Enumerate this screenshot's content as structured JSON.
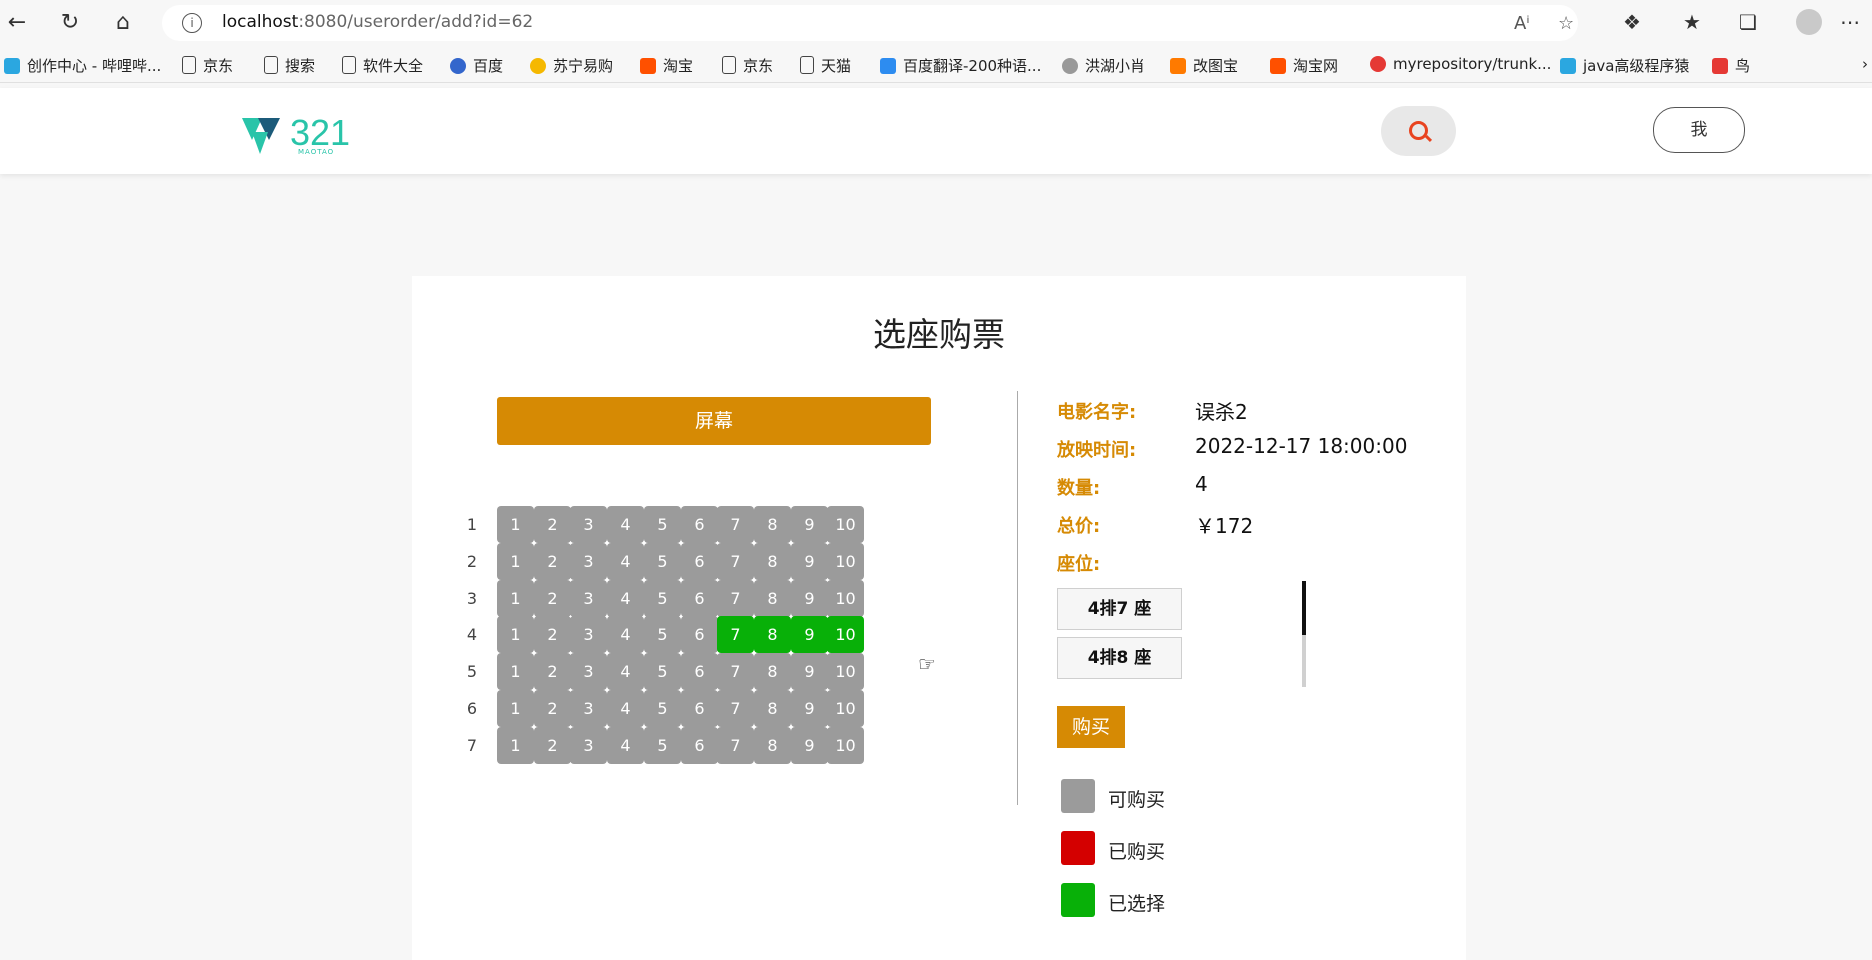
{
  "browser": {
    "url_host": "localhost",
    "url_path": ":8080/userorder/add?id=62",
    "bookmarks": [
      "创作中心 - 哔哩哔...",
      "京东",
      "搜索",
      "软件大全",
      "百度",
      "苏宁易购",
      "淘宝",
      "京东",
      "天猫",
      "百度翻译-200种语...",
      "洪湖小肖",
      "改图宝",
      "淘宝网",
      "myrepository/trunk...",
      "java高级程序猿",
      "鸟"
    ]
  },
  "header": {
    "logo_text": "321",
    "logo_sub": "MAOTAO",
    "me_label": "我"
  },
  "page": {
    "title": "选座购票",
    "screen_label": "屏幕"
  },
  "seat_map": {
    "rows": [
      "1",
      "2",
      "3",
      "4",
      "5",
      "6",
      "7"
    ],
    "seats": [
      "1",
      "2",
      "3",
      "4",
      "5",
      "6",
      "7",
      "8",
      "9",
      "10"
    ],
    "selected": [
      [
        4,
        7
      ],
      [
        4,
        8
      ],
      [
        4,
        9
      ],
      [
        4,
        10
      ]
    ]
  },
  "order": {
    "movie_label": "电影名字:",
    "movie": "误杀2",
    "time_label": "放映时间:",
    "time": "2022-12-17 18:00:00",
    "qty_label": "数量:",
    "qty": "4",
    "price_label": "总价:",
    "price": "￥172",
    "seat_label": "座位:",
    "chosen_seats": [
      "4排7 座",
      "4排8 座"
    ],
    "buy_label": "购买"
  },
  "legend": {
    "available": "可购买",
    "bought": "已购买",
    "chosen": "已选择"
  },
  "colors": {
    "accent": "#d68a04",
    "seat_available": "#9b9b9b",
    "seat_bought": "#d40000",
    "seat_selected": "#08b008",
    "logo": "#29c4a9"
  }
}
